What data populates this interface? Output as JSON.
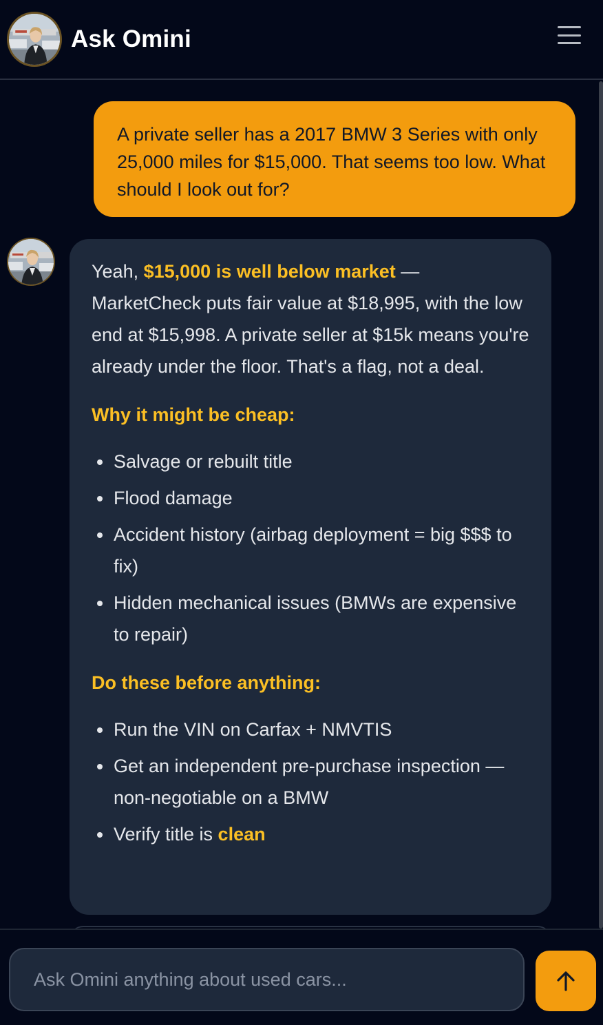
{
  "header": {
    "title": "Ask Omini",
    "avatar_icon": "agent-avatar",
    "menu_icon": "hamburger-menu-icon"
  },
  "colors": {
    "accent": "#f39c0e",
    "highlight": "#fbbf24",
    "background": "#030819",
    "bubble_bg": "#1e293b"
  },
  "messages": {
    "user": {
      "text": "A private seller has a 2017 BMW 3 Series with only 25,000 miles for $15,000. That seems too low. What should I look out for?"
    },
    "assistant": {
      "intro_prefix": "Yeah, ",
      "intro_highlight": "$15,000 is well below market",
      "intro_rest": " — MarketCheck puts fair value at $18,995, with the low end at $15,998. A private seller at $15k means you're already under the floor. That's a flag, not a deal.",
      "section1_heading": "Why it might be cheap:",
      "section1_items": [
        "Salvage or rebuilt title",
        "Flood damage",
        "Accident history (airbag deployment = big $$$ to fix)",
        "Hidden mechanical issues (BMWs are expensive to repair)"
      ],
      "section2_heading": "Do these before anything:",
      "section2_items": [
        "Run the VIN on Carfax + NMVTIS",
        "Get an independent pre-purchase inspection — non-negotiable on a BMW"
      ],
      "section2_last_prefix": "Verify title is ",
      "section2_last_highlight": "clean"
    }
  },
  "composer": {
    "placeholder": "Ask Omini anything about used cars...",
    "send_icon": "arrow-up-icon"
  }
}
